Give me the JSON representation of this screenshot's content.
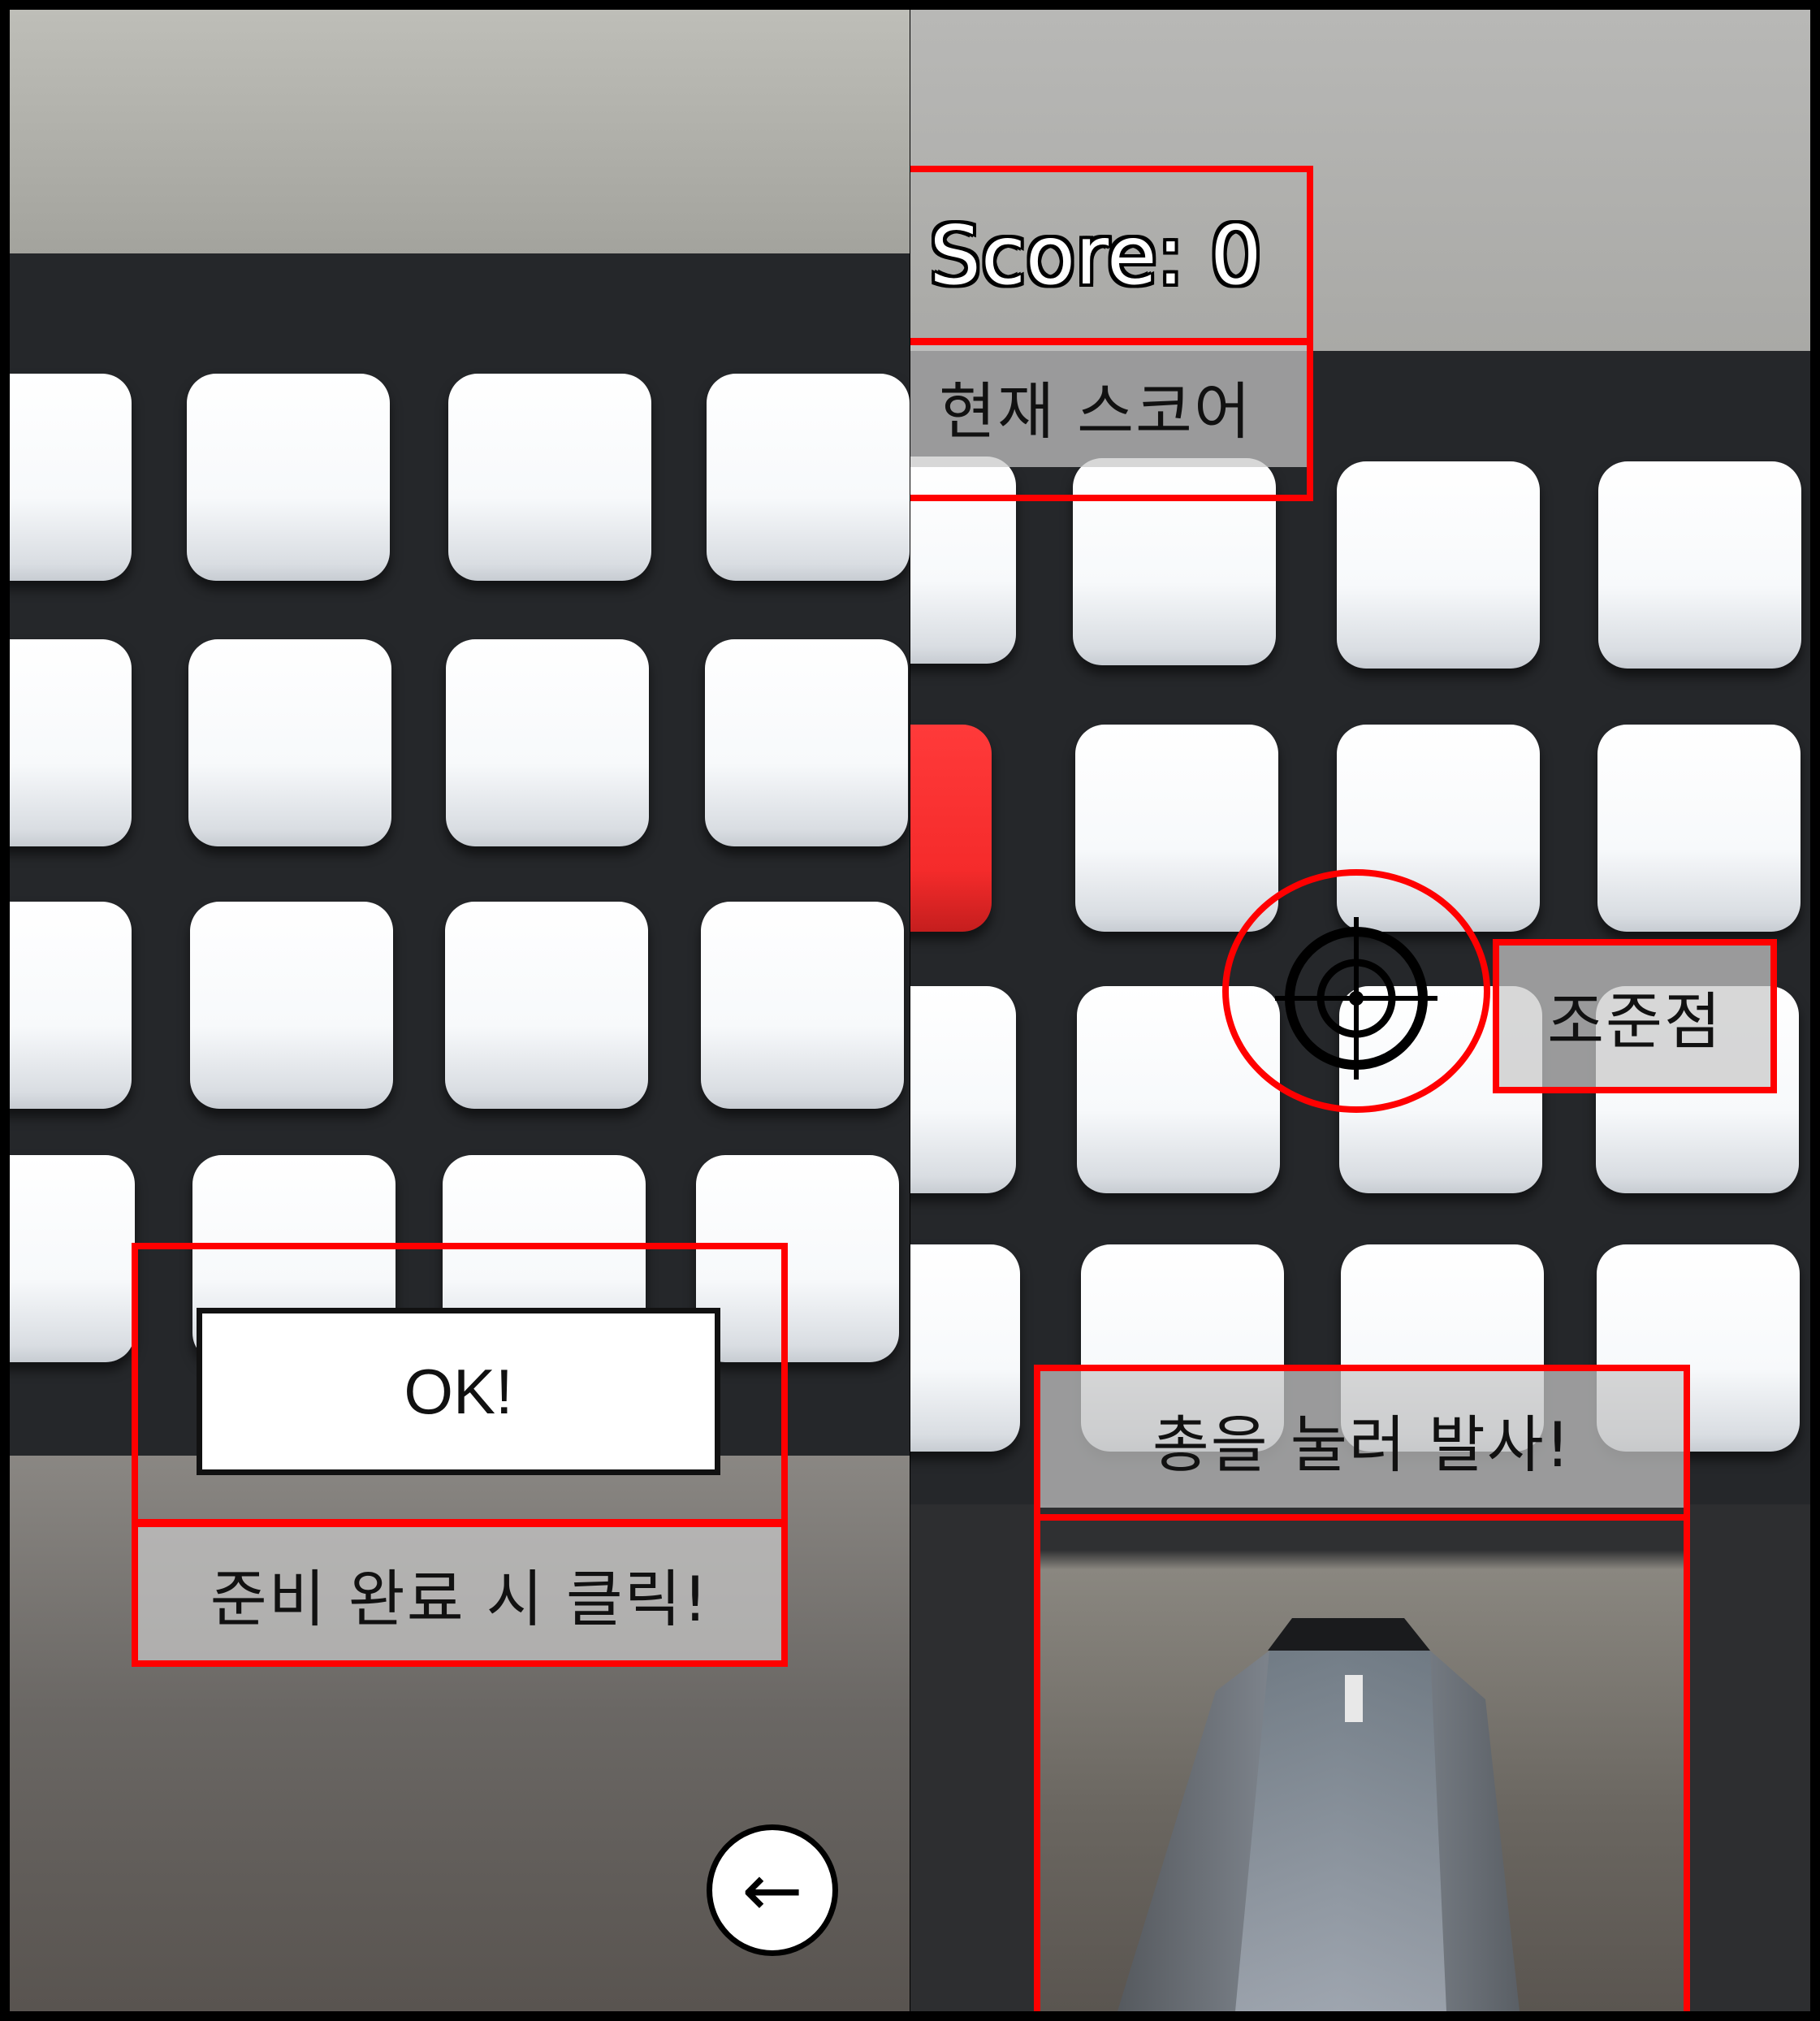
{
  "left_screen": {
    "ok_button_label": "OK!",
    "ready_hint": "준비 완료 시 클릭!",
    "back_button_glyph": "←"
  },
  "right_screen": {
    "score_label": "Score: 0",
    "score_caption": "현재 스코어",
    "crosshair_caption": "조준점",
    "fire_hint": "총을 눌러 발사!"
  },
  "colors": {
    "annotation_box": "#ff0000",
    "target_tile": "#ffffff",
    "active_target": "#f52b2b",
    "board": "#25272a"
  },
  "icons": {
    "crosshair": "crosshair-icon",
    "back": "back-arrow-icon"
  }
}
